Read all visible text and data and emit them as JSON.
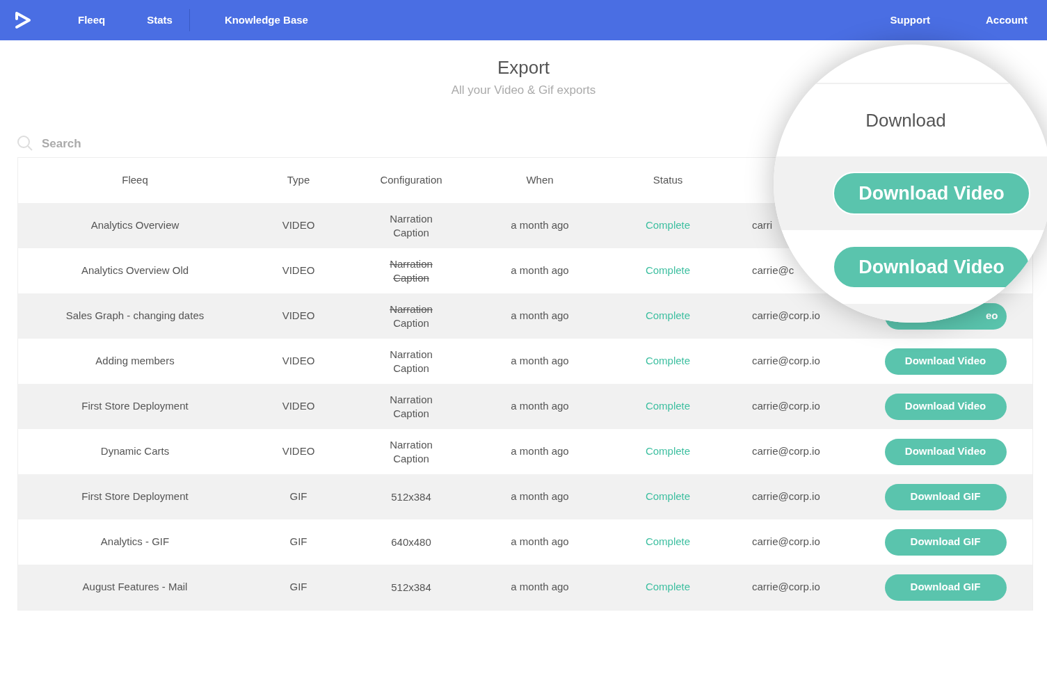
{
  "nav": {
    "left": [
      "Fleeq",
      "Stats"
    ],
    "right_of_divider": [
      "Knowledge Base"
    ],
    "right": [
      "Support",
      "Account"
    ]
  },
  "page": {
    "title": "Export",
    "subtitle": "All your Video & Gif exports"
  },
  "search": {
    "placeholder": "Search"
  },
  "table": {
    "columns": [
      "Fleeq",
      "Type",
      "Configuration",
      "When",
      "Status"
    ],
    "rows": [
      {
        "fleeq": "Analytics Overview",
        "type": "VIDEO",
        "config": [
          {
            "text": "Narration",
            "struck": false
          },
          {
            "text": "Caption",
            "struck": false
          }
        ],
        "when": "a month ago",
        "status": "Complete",
        "email": "carri"
      },
      {
        "fleeq": "Analytics Overview Old",
        "type": "VIDEO",
        "config": [
          {
            "text": "Narration",
            "struck": true
          },
          {
            "text": "Caption",
            "struck": true
          }
        ],
        "when": "a month ago",
        "status": "Complete",
        "email": "carrie@c"
      },
      {
        "fleeq": "Sales Graph - changing  dates",
        "type": "VIDEO",
        "config": [
          {
            "text": "Narration",
            "struck": true
          },
          {
            "text": "Caption",
            "struck": false
          }
        ],
        "when": "a month ago",
        "status": "Complete",
        "email": "carrie@corp.io",
        "download": "eo"
      },
      {
        "fleeq": "Adding members",
        "type": "VIDEO",
        "config": [
          {
            "text": "Narration",
            "struck": false
          },
          {
            "text": "Caption",
            "struck": false
          }
        ],
        "when": "a month ago",
        "status": "Complete",
        "email": "carrie@corp.io",
        "download": "Download Video"
      },
      {
        "fleeq": "First Store Deployment",
        "type": "VIDEO",
        "config": [
          {
            "text": "Narration",
            "struck": false
          },
          {
            "text": "Caption",
            "struck": false
          }
        ],
        "when": "a month ago",
        "status": "Complete",
        "email": "carrie@corp.io",
        "download": "Download Video"
      },
      {
        "fleeq": "Dynamic Carts",
        "type": "VIDEO",
        "config": [
          {
            "text": "Narration",
            "struck": false
          },
          {
            "text": "Caption",
            "struck": false
          }
        ],
        "when": "a month ago",
        "status": "Complete",
        "email": "carrie@corp.io",
        "download": "Download Video"
      },
      {
        "fleeq": "First Store Deployment",
        "type": "GIF",
        "config": [
          {
            "text": "512x384",
            "struck": false
          }
        ],
        "when": "a month ago",
        "status": "Complete",
        "email": "carrie@corp.io",
        "download": "Download GIF"
      },
      {
        "fleeq": "Analytics - GIF",
        "type": "GIF",
        "config": [
          {
            "text": "640x480",
            "struck": false
          }
        ],
        "when": "a month ago",
        "status": "Complete",
        "email": "carrie@corp.io",
        "download": "Download GIF"
      },
      {
        "fleeq": "August Features - Mail",
        "type": "GIF",
        "config": [
          {
            "text": "512x384",
            "struck": false
          }
        ],
        "when": "a month ago",
        "status": "Complete",
        "email": "carrie@corp.io",
        "download": "Download GIF"
      }
    ]
  },
  "magnifier": {
    "header": "Download",
    "buttons": [
      "Download Video",
      "Download Video"
    ]
  }
}
